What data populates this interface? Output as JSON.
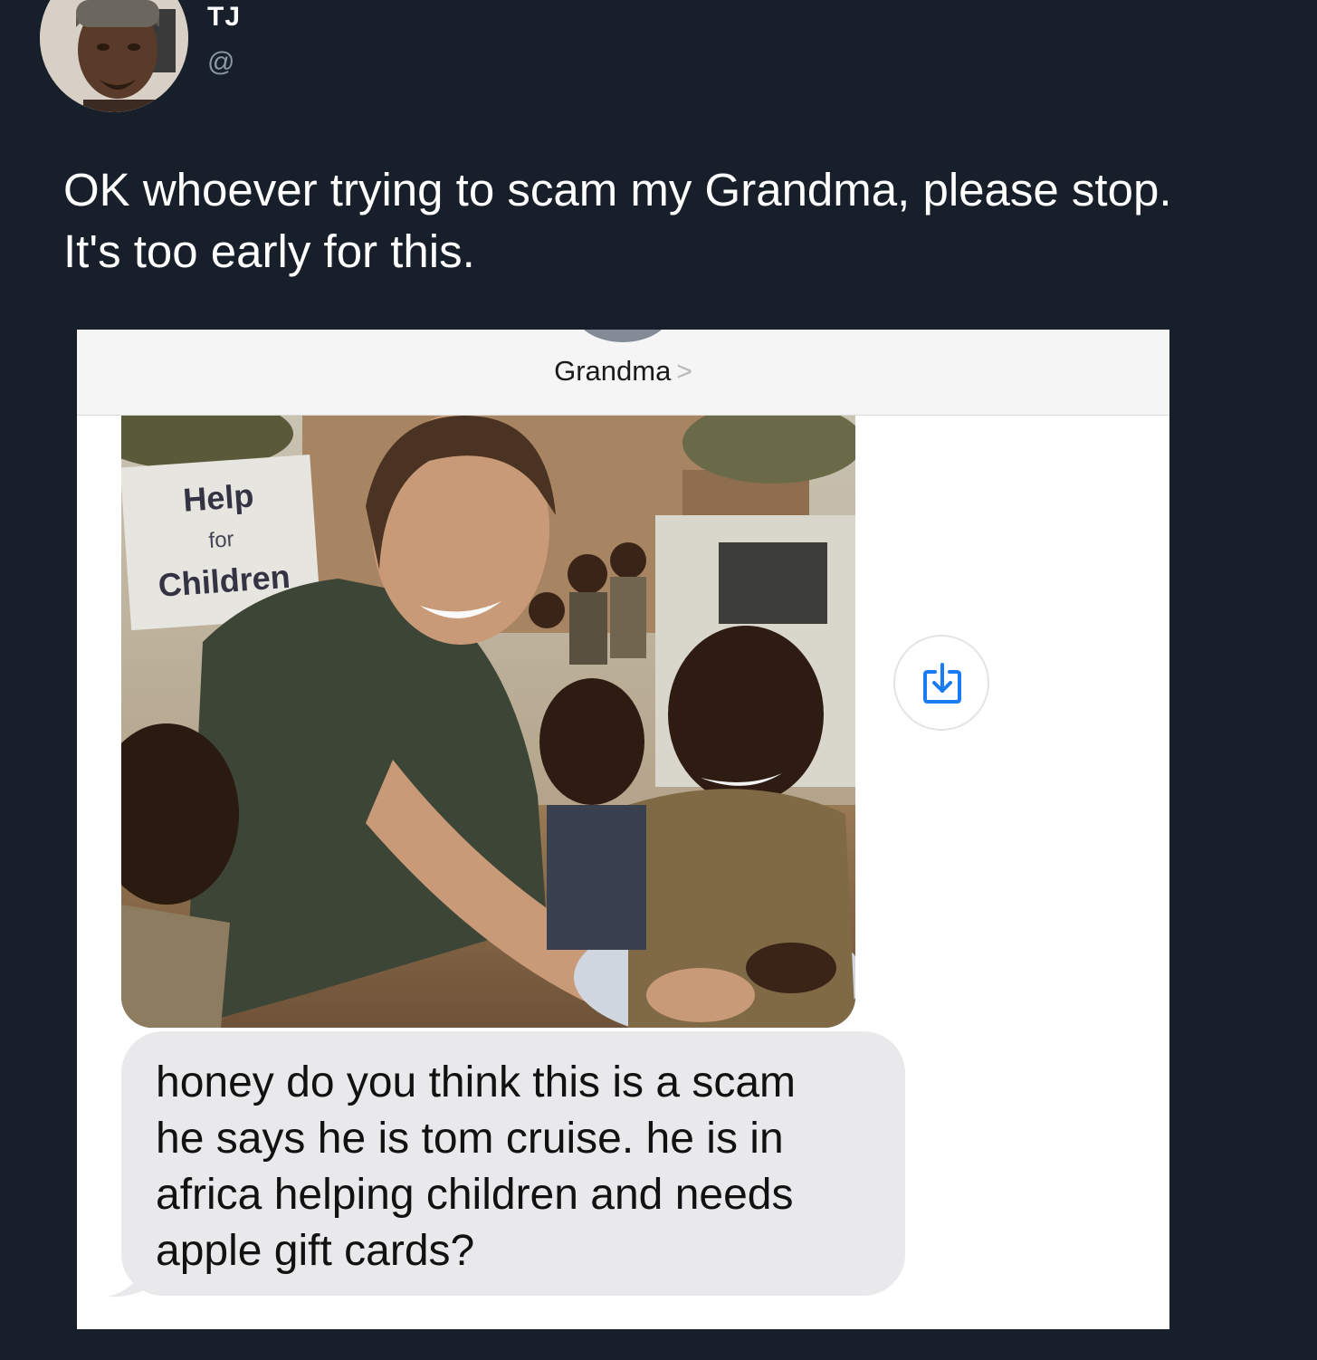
{
  "tweet": {
    "author_name": "TJ",
    "author_handle": "@",
    "text_line1": "OK whoever trying to scam my Grandma, please stop.",
    "text_line2": "It's too early for this."
  },
  "messages_screenshot": {
    "contact_name": "Grandma",
    "contact_chevron": ">",
    "photo": {
      "banner_line1": "Help",
      "banner_line2": "for",
      "banner_line3": "Children"
    },
    "save_icon": "download-tray-icon",
    "message_lines": [
      "honey do you think this is a scam",
      "he says he is tom cruise. he is in",
      "africa helping children and needs",
      "apple gift cards?"
    ]
  },
  "colors": {
    "page_background": "#17202a",
    "tweet_text": "#ffffff",
    "handle_text": "#8b98a5",
    "bubble_background": "#e9e9eb",
    "ios_blue": "#1a7cf5"
  }
}
